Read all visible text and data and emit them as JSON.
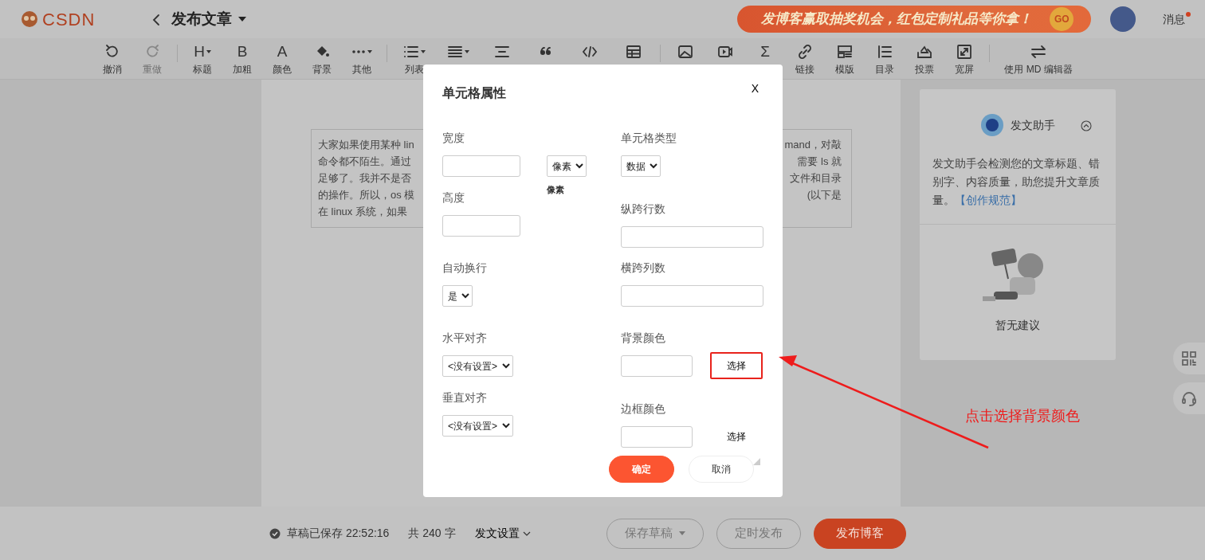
{
  "header": {
    "logo": "CSDN",
    "title": "发布文章",
    "banner": {
      "text": "发博客赢取抽奖机会，红包定制礼品等你拿！",
      "go": "GO"
    },
    "messages": {
      "label": "消息",
      "unread": true
    }
  },
  "toolbar": [
    [
      {
        "label": "撤消",
        "dropdown": false,
        "disabled": false
      },
      {
        "label": "重做",
        "dropdown": false,
        "disabled": true
      }
    ],
    [
      {
        "glyph": "H",
        "label": "标题",
        "dropdown": true,
        "disabled": false
      },
      {
        "glyph": "B",
        "label": "加粗",
        "dropdown": false,
        "disabled": false
      },
      {
        "glyph": "A",
        "label": "颜色",
        "dropdown": false,
        "disabled": false
      },
      {
        "label": "背景",
        "dropdown": false,
        "disabled": false
      },
      {
        "label": "其他",
        "dropdown": true,
        "disabled": false
      }
    ],
    [
      {
        "label": "列表",
        "dropdown": true,
        "disabled": false
      },
      {
        "dropdown": true,
        "disabled": false
      },
      {
        "dropdown": false,
        "disabled": false
      },
      {
        "dropdown": false,
        "disabled": false
      },
      {
        "dropdown": false,
        "disabled": false
      },
      {
        "dropdown": false,
        "disabled": false
      }
    ],
    [
      {
        "dropdown": false,
        "disabled": false
      },
      {
        "dropdown": false,
        "disabled": false
      },
      {
        "glyph": "Σ",
        "dropdown": false,
        "disabled": false
      },
      {
        "label": "链接",
        "dropdown": false,
        "disabled": false
      },
      {
        "label": "模版",
        "dropdown": false,
        "disabled": false
      },
      {
        "label": "目录",
        "dropdown": false,
        "disabled": false
      },
      {
        "label": "投票",
        "dropdown": false,
        "disabled": false
      },
      {
        "label": "宽屏",
        "dropdown": false,
        "disabled": false
      }
    ],
    [
      {
        "label": "使用 MD 编辑器",
        "dropdown": false,
        "disabled": false
      }
    ]
  ],
  "editor": {
    "left_lines": [
      "大家如果使用某种 lin",
      "命令都不陌生。通过",
      "足够了。我并不是否",
      "的操作。所以，os 模",
      "在 linux 系统，如果"
    ],
    "right_lines": [
      "mand，对敲",
      "需要 ls 就",
      "文件和目录",
      "(以下是"
    ]
  },
  "assistant": {
    "title": "发文助手",
    "expanded": true,
    "description": "发文助手会检测您的文章标题、错别字、内容质量，助您提升文章质量。",
    "link": "【创作规范】",
    "empty": "暂无建议"
  },
  "dialog": {
    "title": "单元格属性",
    "close": "X",
    "left": [
      {
        "kind": "input",
        "label": "宽度"
      },
      {
        "kind": "input",
        "label": "高度"
      },
      {
        "kind": "select",
        "label": "自动换行",
        "value": "是"
      },
      {
        "kind": "select",
        "label": "水平对齐",
        "value": "<没有设置>"
      },
      {
        "kind": "select",
        "label": "垂直对齐",
        "value": "<没有设置>"
      }
    ],
    "unit": {
      "value": "像素",
      "note": "像素"
    },
    "right": [
      {
        "kind": "select",
        "label": "单元格类型",
        "value": "数据"
      },
      {
        "kind": "input",
        "label": "纵跨行数"
      },
      {
        "kind": "input",
        "label": "横跨列数"
      },
      {
        "kind": "color",
        "label": "背景颜色",
        "button": "选择",
        "highlighted": true
      },
      {
        "kind": "color",
        "label": "边框颜色",
        "button": "选择",
        "highlighted": false
      }
    ],
    "buttons": [
      {
        "label": "确定",
        "primary": true
      },
      {
        "label": "取消",
        "primary": false
      }
    ]
  },
  "annotation": {
    "text": "点击选择背景颜色"
  },
  "status_bar": {
    "saved": "草稿已保存 22:52:16",
    "count": "共 240 字",
    "settings": "发文设置",
    "buttons": [
      {
        "label": "保存草稿",
        "kind": "dropdown"
      },
      {
        "label": "定时发布",
        "kind": "outline"
      },
      {
        "label": "发布博客",
        "kind": "primary"
      }
    ]
  }
}
